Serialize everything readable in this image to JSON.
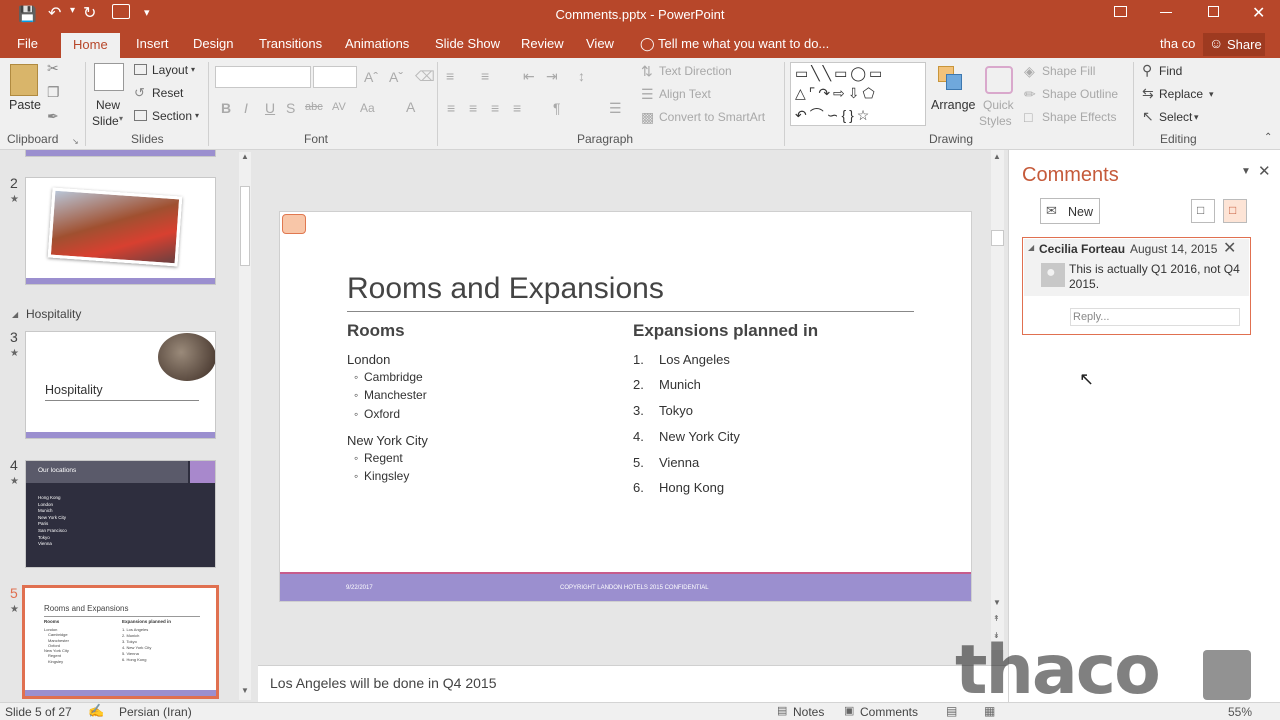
{
  "window": {
    "title": "Comments.pptx - PowerPoint"
  },
  "colors": {
    "accent": "#b7472a",
    "footer": "#9b8fcf",
    "selected_thumb": "#e07050"
  },
  "tabs": {
    "file": "File",
    "home": "Home",
    "insert": "Insert",
    "design": "Design",
    "transitions": "Transitions",
    "animations": "Animations",
    "slide_show": "Slide Show",
    "review": "Review",
    "view": "View",
    "tell_me": "Tell me what you want to do...",
    "user": "tha co",
    "share": "Share"
  },
  "ribbon": {
    "clipboard": {
      "paste": "Paste",
      "label": "Clipboard"
    },
    "slides": {
      "new_line1": "New",
      "new_line2": "Slide",
      "layout": "Layout",
      "reset": "Reset",
      "section": "Section",
      "label": "Slides"
    },
    "font": {
      "label": "Font"
    },
    "paragraph": {
      "text_direction": "Text Direction",
      "align_text": "Align Text",
      "convert_smartart": "Convert to SmartArt",
      "label": "Paragraph"
    },
    "drawing": {
      "arrange": "Arrange",
      "quick": "Quick",
      "styles": "Styles",
      "shape_fill": "Shape Fill",
      "shape_outline": "Shape Outline",
      "shape_effects": "Shape Effects",
      "label": "Drawing"
    },
    "editing": {
      "find": "Find",
      "replace": "Replace",
      "select": "Select",
      "label": "Editing"
    }
  },
  "thumbnails": {
    "section": "Hospitality",
    "s2": {
      "num": "2"
    },
    "s3": {
      "num": "3",
      "title": "Hospitality"
    },
    "s4": {
      "num": "4",
      "title": "Our locations",
      "items": [
        "Hong Kong",
        "London",
        "Munich",
        "New York City",
        "Paris",
        "San Francisco",
        "Tokyo",
        "Vienna"
      ]
    },
    "s5": {
      "num": "5",
      "title": "Rooms and Expansions",
      "rooms": "Rooms",
      "exp": "Expansions planned in",
      "left": [
        "London",
        "Cambridge",
        "Manchester",
        "Oxford",
        "New York City",
        "Regent",
        "Kingsley"
      ],
      "right": [
        "1.  Los Angeles",
        "2.  Munich",
        "3.  Tokyo",
        "4.  New York City",
        "5.  Vienna",
        "6.  Hong Kong"
      ]
    }
  },
  "slide": {
    "title": "Rooms and Expansions",
    "left_heading": "Rooms",
    "city1": "London",
    "city1_items": [
      "Cambridge",
      "Manchester",
      "Oxford"
    ],
    "city2": "New York City",
    "city2_items": [
      "Regent",
      "Kingsley"
    ],
    "right_heading": "Expansions planned in",
    "expansions": [
      {
        "n": "1.",
        "t": "Los Angeles"
      },
      {
        "n": "2.",
        "t": "Munich"
      },
      {
        "n": "3.",
        "t": "Tokyo"
      },
      {
        "n": "4.",
        "t": "New York City"
      },
      {
        "n": "5.",
        "t": "Vienna"
      },
      {
        "n": "6.",
        "t": "Hong Kong"
      }
    ],
    "footer_date": "9/22/2017",
    "footer_text": "COPYRIGHT LANDON HOTELS 2015 CONFIDENTIAL"
  },
  "notes": {
    "text": "Los Angeles will be done in Q4 2015"
  },
  "comments": {
    "title": "Comments",
    "new": "New",
    "author": "Cecilia Forteau",
    "date": "August 14, 2015",
    "body_line1": "This is actually Q1 2016, not Q4",
    "body_line2": "2015.",
    "reply_placeholder": "Reply..."
  },
  "status": {
    "slide": "Slide 5 of 27",
    "language": "Persian (Iran)",
    "notes": "Notes",
    "comments": "Comments",
    "zoom": "55%"
  },
  "watermark": "thaco.ir"
}
